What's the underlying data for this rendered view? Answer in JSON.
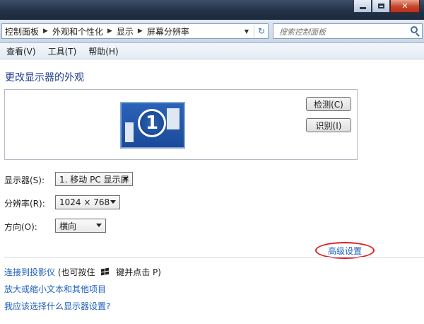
{
  "navbar": {
    "breadcrumb": [
      "控制面板",
      "外观和个性化",
      "显示",
      "屏幕分辨率"
    ],
    "search_placeholder": "搜索控制面板"
  },
  "menubar": {
    "items": [
      "查看(V)",
      "工具(T)",
      "帮助(H)"
    ]
  },
  "main": {
    "title": "更改显示器的外观",
    "monitor_number": "1",
    "detect_label": "检测(C)",
    "identify_label": "识别(I)",
    "display_label": "显示器(S):",
    "display_value": "1. 移动 PC 显示屏",
    "resolution_label": "分辨率(R):",
    "resolution_value": "1024 × 768",
    "orientation_label": "方向(O):",
    "orientation_value": "横向",
    "advanced_link": "高级设置"
  },
  "links": {
    "projector": "连接到投影仪",
    "projector_hint_pre": "(也可按住",
    "projector_hint_post": "键并点击 P)",
    "text_size": "放大或缩小文本和其他项目",
    "which_settings": "我应该选择什么显示器设置?"
  },
  "colors": {
    "link": "#1f5fbf",
    "title": "#1e3d8f",
    "highlight_ring": "#e02020"
  },
  "icons": {
    "windows_key": "windows-logo-icon",
    "search": "magnifier-icon",
    "refresh": "refresh-icon"
  }
}
